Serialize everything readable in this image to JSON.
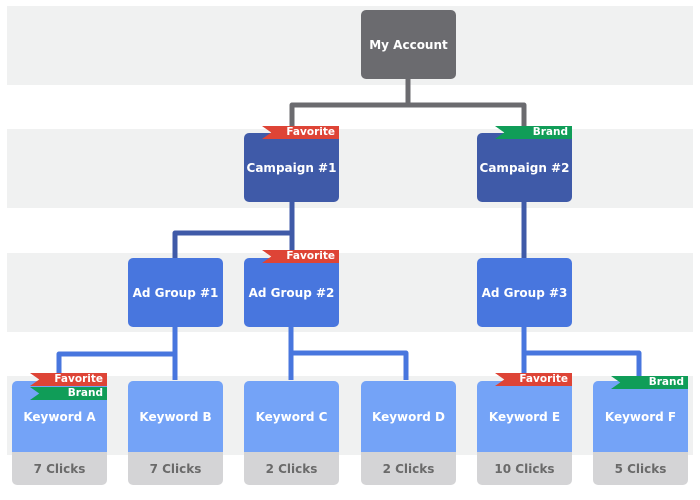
{
  "colors": {
    "account": "#6b6b6f",
    "campaign": "#3f5aa8",
    "adgroup": "#4876de",
    "keyword": "#74a3f7",
    "clicks_bg": "#d4d4d6",
    "favorite_flag": "#de4436",
    "brand_flag": "#109d58",
    "band": "#f0f1f1"
  },
  "account": {
    "label": "My Account"
  },
  "campaigns": [
    {
      "label": "Campaign #1",
      "flags": [
        "Favorite"
      ]
    },
    {
      "label": "Campaign #2",
      "flags": [
        "Brand"
      ]
    }
  ],
  "adgroups": [
    {
      "label": "Ad Group #1",
      "parent": "Campaign #1",
      "flags": []
    },
    {
      "label": "Ad Group #2",
      "parent": "Campaign #1",
      "flags": [
        "Favorite"
      ]
    },
    {
      "label": "Ad Group #3",
      "parent": "Campaign #2",
      "flags": []
    }
  ],
  "keywords": [
    {
      "label": "Keyword A",
      "parent": "Ad Group #1",
      "clicks": "7 Clicks",
      "flags": [
        "Favorite",
        "Brand"
      ]
    },
    {
      "label": "Keyword B",
      "parent": "Ad Group #1",
      "clicks": "7 Clicks",
      "flags": []
    },
    {
      "label": "Keyword C",
      "parent": "Ad Group #2",
      "clicks": "2 Clicks",
      "flags": []
    },
    {
      "label": "Keyword D",
      "parent": "Ad Group #2",
      "clicks": "2 Clicks",
      "flags": []
    },
    {
      "label": "Keyword E",
      "parent": "Ad Group #3",
      "clicks": "10 Clicks",
      "flags": [
        "Favorite"
      ]
    },
    {
      "label": "Keyword F",
      "parent": "Ad Group #3",
      "clicks": "5 Clicks",
      "flags": [
        "Brand"
      ]
    }
  ],
  "flag_labels": {
    "favorite": "Favorite",
    "brand": "Brand"
  }
}
